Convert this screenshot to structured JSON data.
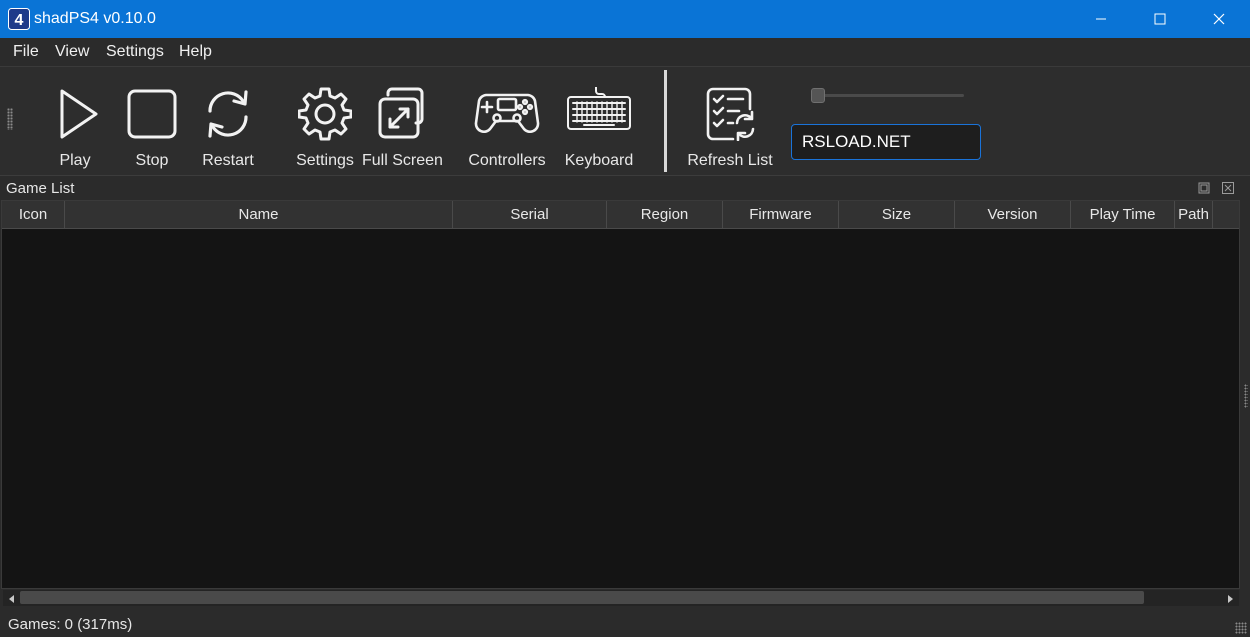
{
  "window": {
    "title": "shadPS4 v0.10.0",
    "app_icon": "ps4-logo-icon",
    "controls": [
      "minimize-icon",
      "maximize-icon",
      "close-icon"
    ],
    "title_bar_color": "#0a74d6"
  },
  "menu": {
    "items": [
      {
        "label": "File"
      },
      {
        "label": "View"
      },
      {
        "label": "Settings"
      },
      {
        "label": "Help"
      }
    ]
  },
  "toolbar": {
    "buttons": [
      {
        "label": "Play",
        "icon": "play-icon"
      },
      {
        "label": "Stop",
        "icon": "stop-icon"
      },
      {
        "label": "Restart",
        "icon": "restart-icon"
      },
      {
        "label": "Settings",
        "icon": "gear-icon"
      },
      {
        "label": "Full Screen",
        "icon": "fullscreen-icon"
      },
      {
        "label": "Controllers",
        "icon": "gamepad-icon"
      },
      {
        "label": "Keyboard",
        "icon": "keyboard-icon"
      },
      {
        "label": "Refresh List",
        "icon": "refresh-list-icon"
      }
    ],
    "icon_size_slider": {
      "value": 0
    },
    "search": {
      "value": "RSLOAD.NET",
      "placeholder": ""
    },
    "accent_color": "#1a73d9"
  },
  "game_list": {
    "title": "Game List",
    "columns": [
      "Icon",
      "Name",
      "Serial",
      "Region",
      "Firmware",
      "Size",
      "Version",
      "Play Time",
      "Path"
    ],
    "rows": []
  },
  "status": {
    "text": "Games: 0 (317ms)"
  }
}
